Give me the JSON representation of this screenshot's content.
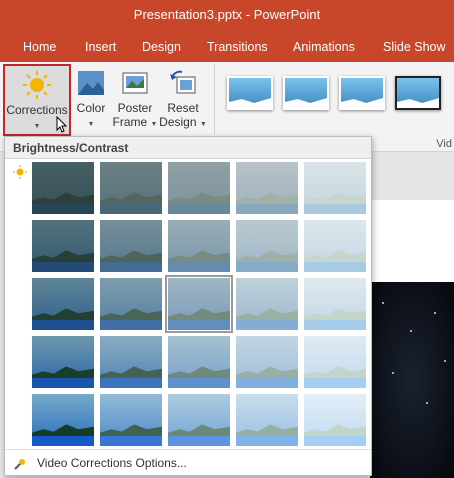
{
  "window": {
    "title": "Presentation3.pptx - PowerPoint"
  },
  "tabs": [
    {
      "label": "Home"
    },
    {
      "label": "Insert"
    },
    {
      "label": "Design"
    },
    {
      "label": "Transitions"
    },
    {
      "label": "Animations"
    },
    {
      "label": "Slide Show"
    }
  ],
  "ribbon": {
    "corrections": "Corrections",
    "color": "Color",
    "poster_frame_1": "Poster",
    "poster_frame_2": "Frame",
    "reset_design_1": "Reset",
    "reset_design_2": "Design",
    "group_label": "Vid"
  },
  "dropdown": {
    "header": "Brightness/Contrast",
    "footer": "Video Corrections Options...",
    "rows": 5,
    "cols": 5,
    "selected_row": 2,
    "selected_col": 2
  },
  "colors": {
    "accent": "#c8472b",
    "selection": "#c0262c"
  }
}
